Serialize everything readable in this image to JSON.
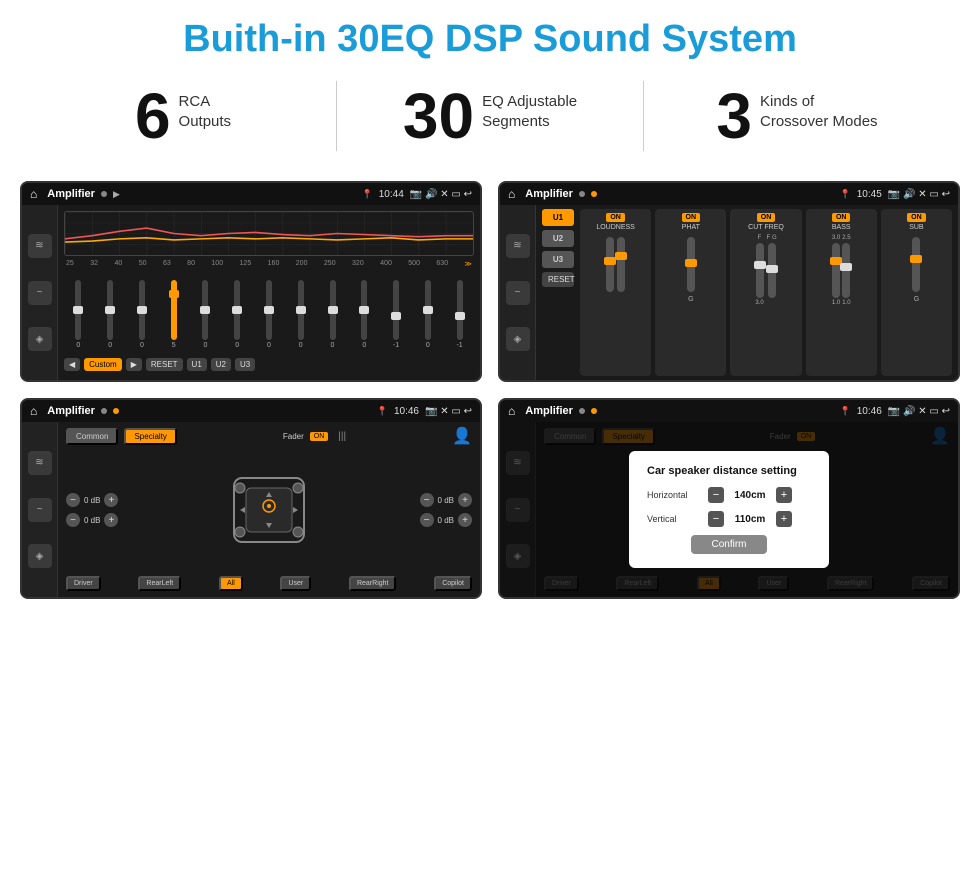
{
  "page": {
    "title": "Buith-in 30EQ DSP Sound System"
  },
  "stats": [
    {
      "number": "6",
      "label": "RCA\nOutputs"
    },
    {
      "number": "30",
      "label": "EQ Adjustable\nSegments"
    },
    {
      "number": "3",
      "label": "Kinds of\nCrossover Modes"
    }
  ],
  "screens": [
    {
      "id": "eq-screen",
      "statusBar": {
        "title": "Amplifier",
        "time": "10:44"
      },
      "type": "eq"
    },
    {
      "id": "crossover-screen",
      "statusBar": {
        "title": "Amplifier",
        "time": "10:45"
      },
      "type": "crossover"
    },
    {
      "id": "fader-screen",
      "statusBar": {
        "title": "Amplifier",
        "time": "10:46"
      },
      "type": "fader"
    },
    {
      "id": "dialog-screen",
      "statusBar": {
        "title": "Amplifier",
        "time": "10:46"
      },
      "type": "dialog",
      "dialog": {
        "title": "Car speaker distance setting",
        "horizontal": "140cm",
        "vertical": "110cm",
        "confirmLabel": "Confirm"
      }
    }
  ],
  "eq": {
    "freqs": [
      "25",
      "32",
      "40",
      "50",
      "63",
      "80",
      "100",
      "125",
      "160",
      "200",
      "250",
      "320",
      "400",
      "500",
      "630"
    ],
    "values": [
      "0",
      "0",
      "0",
      "5",
      "0",
      "0",
      "0",
      "0",
      "0",
      "0",
      "-1",
      "0",
      "-1"
    ],
    "buttons": [
      "Custom",
      "RESET",
      "U1",
      "U2",
      "U3"
    ]
  },
  "crossover": {
    "units": [
      "U1",
      "U2",
      "U3"
    ],
    "panels": [
      "LOUDNESS",
      "PHAT",
      "CUT FREQ",
      "BASS",
      "SUB"
    ],
    "resetLabel": "RESET"
  },
  "fader": {
    "tabs": [
      "Common",
      "Specialty"
    ],
    "faderLabel": "Fader",
    "onLabel": "ON",
    "dbValues": [
      "0 dB",
      "0 dB",
      "0 dB",
      "0 dB"
    ],
    "bottomBtns": [
      "Driver",
      "RearLeft",
      "All",
      "User",
      "RearRight",
      "Copilot"
    ]
  },
  "dialog": {
    "title": "Car speaker distance setting",
    "horizontalLabel": "Horizontal",
    "horizontalValue": "140cm",
    "verticalLabel": "Vertical",
    "verticalValue": "110cm",
    "confirmLabel": "Confirm"
  }
}
